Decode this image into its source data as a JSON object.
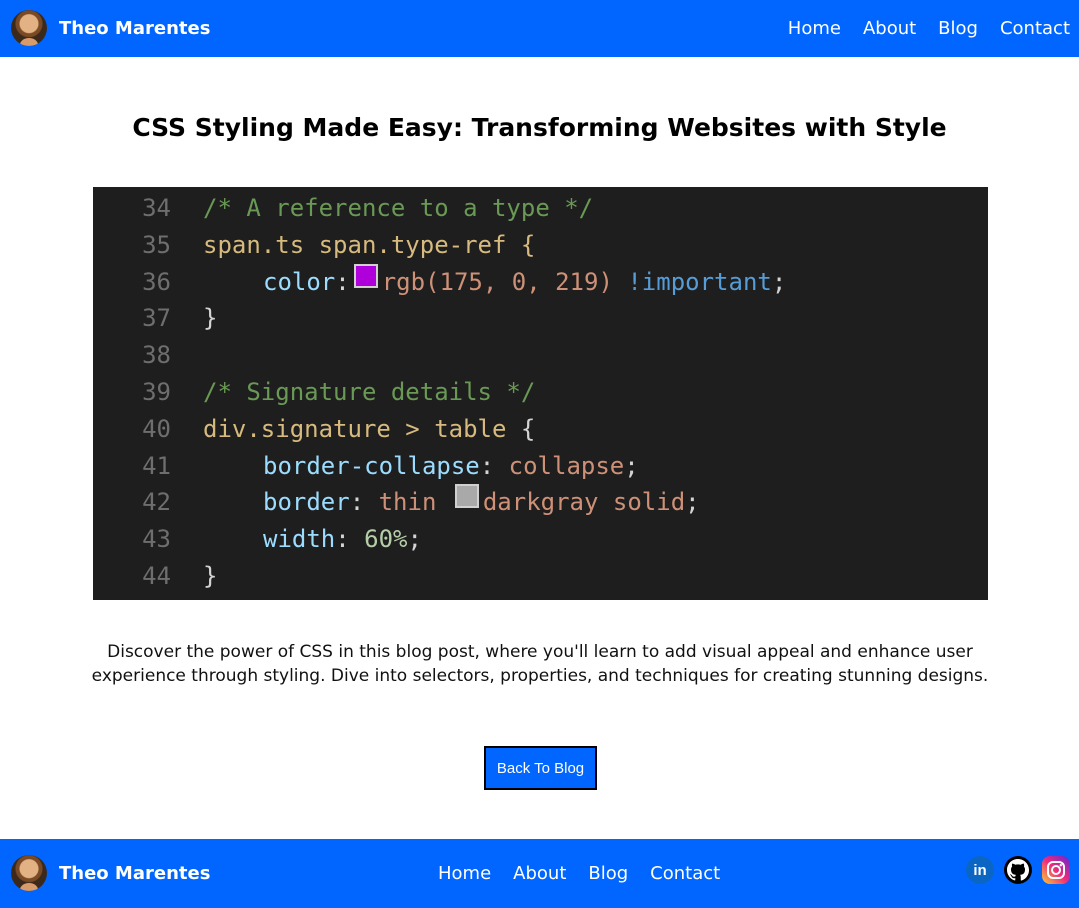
{
  "header": {
    "brand_name": "Theo Marentes",
    "nav": [
      "Home",
      "About",
      "Blog",
      "Contact"
    ]
  },
  "post": {
    "title": "CSS Styling Made Easy: Transforming Websites with Style",
    "description": "Discover the power of CSS in this blog post, where you'll learn to add visual appeal and enhance user experience through styling. Dive into selectors, properties, and techniques for creating stunning designs.",
    "code_lines": {
      "n34": "34",
      "n35": "35",
      "n36": "36",
      "n37": "37",
      "n38": "38",
      "n39": "39",
      "n40": "40",
      "n41": "41",
      "n42": "42",
      "n43": "43",
      "n44": "44",
      "l34": "/* A reference to a type */",
      "l35": "span.ts span.type-ref {",
      "l36_prop": "color",
      "l36_colon": ":",
      "l36_val": "rgb(175, 0, 219)",
      "l36_imp": "!important",
      "l36_end": ";",
      "l37": "}",
      "l39": "/* Signature details */",
      "l40_sel": "div.signature > table",
      "l40_brace": "{",
      "l41_prop": "border-collapse",
      "l41_colon": ":",
      "l41_val": "collapse",
      "l41_end": ";",
      "l42_prop": "border",
      "l42_colon": ":",
      "l42_val1": "thin",
      "l42_val2": "darkgray solid",
      "l42_end": ";",
      "l43_prop": "width",
      "l43_colon": ":",
      "l43_val": "60%",
      "l43_end": ";",
      "l44": "}"
    },
    "swatch_colors": {
      "purple": "#af00db",
      "darkgray": "#a9a9a9"
    },
    "back_button": "Back To Blog"
  },
  "footer": {
    "brand_name": "Theo Marentes",
    "nav": [
      "Home",
      "About",
      "Blog",
      "Contact"
    ],
    "social": {
      "linkedin_label": "in"
    }
  },
  "colors": {
    "accent": "#0066ff",
    "code_bg": "#1e1e1e"
  },
  "icons": [
    "avatar",
    "linkedin-icon",
    "github-icon",
    "instagram-icon"
  ]
}
